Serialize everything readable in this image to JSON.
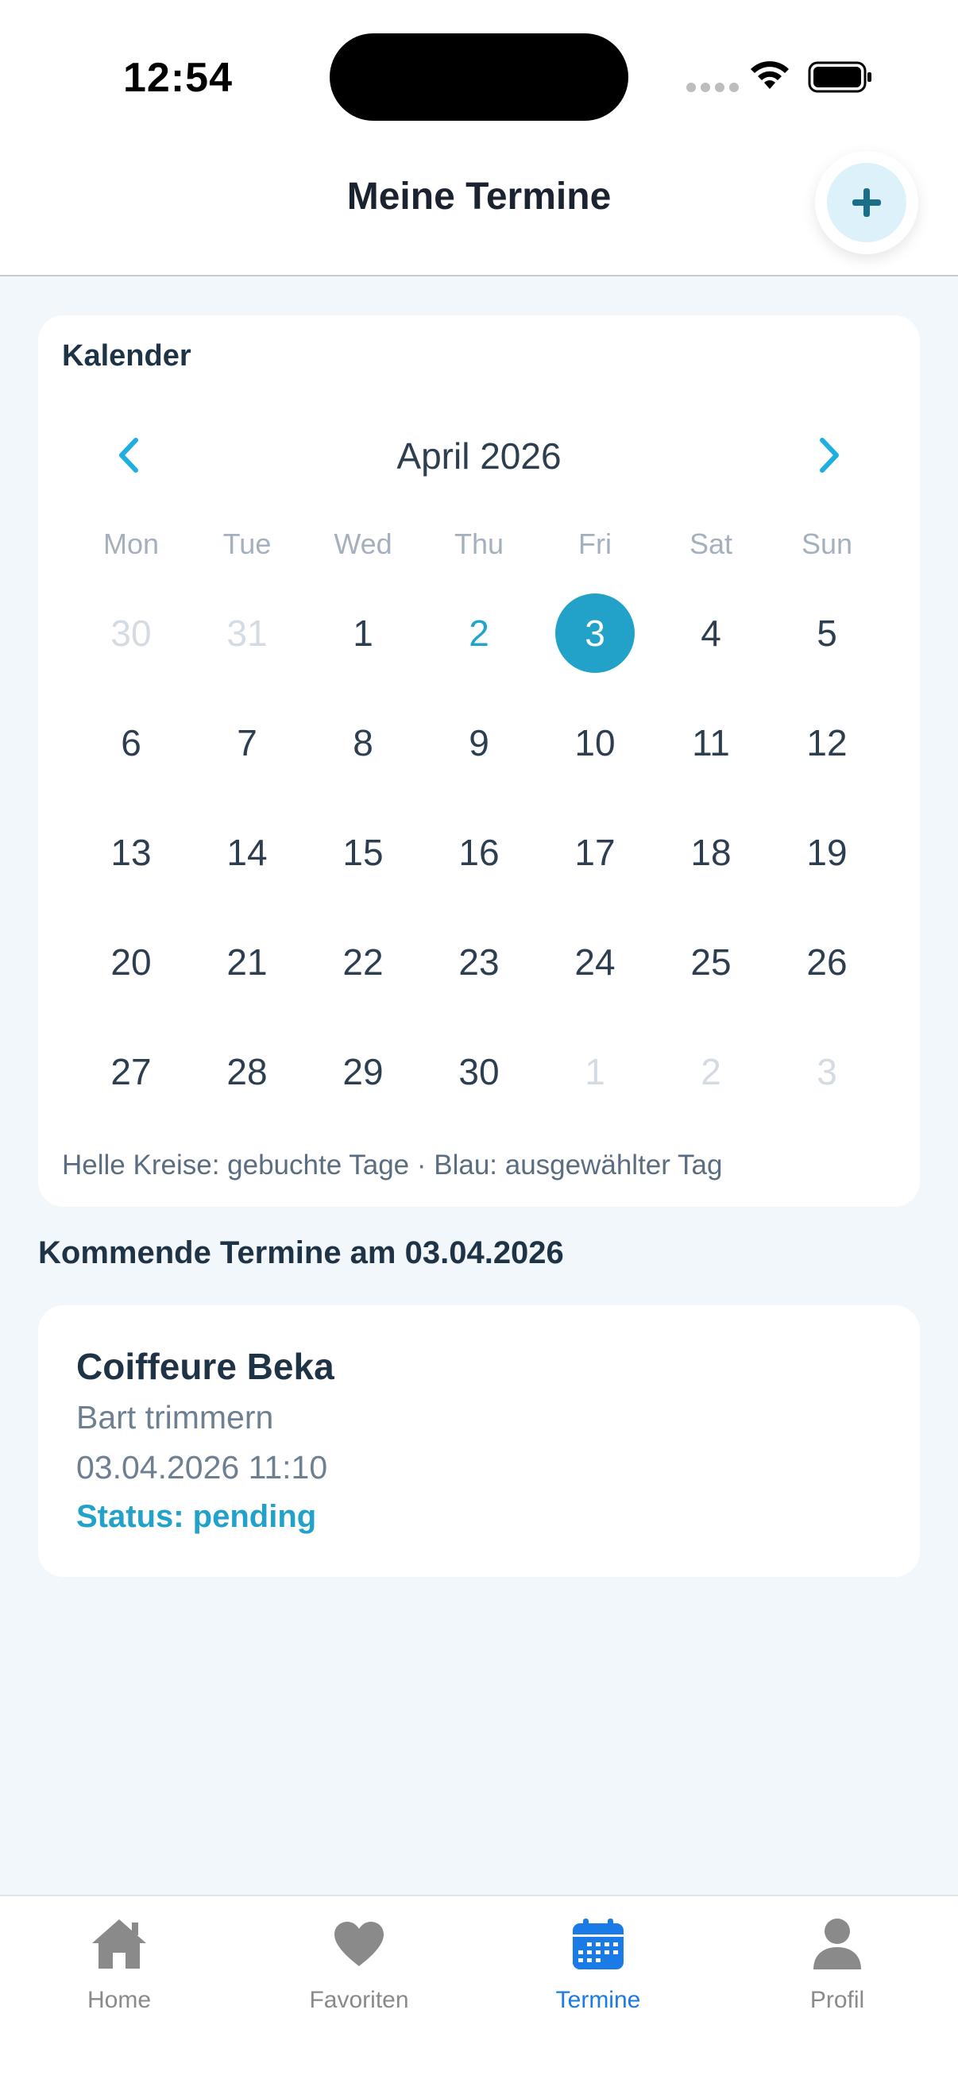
{
  "status_bar": {
    "time": "12:54"
  },
  "header": {
    "title": "Meine Termine",
    "add_label": "+"
  },
  "calendar": {
    "title": "Kalender",
    "month": "April 2026",
    "prev_label": "<",
    "next_label": ">",
    "weekdays": [
      "Mon",
      "Tue",
      "Wed",
      "Thu",
      "Fri",
      "Sat",
      "Sun"
    ],
    "weeks": [
      [
        "30",
        "31",
        "1",
        "2",
        "3",
        "4",
        "5"
      ],
      [
        "6",
        "7",
        "8",
        "9",
        "10",
        "11",
        "12"
      ],
      [
        "13",
        "14",
        "15",
        "16",
        "17",
        "18",
        "19"
      ],
      [
        "20",
        "21",
        "22",
        "23",
        "24",
        "25",
        "26"
      ],
      [
        "27",
        "28",
        "29",
        "30",
        "1",
        "2",
        "3"
      ]
    ],
    "hint": "Helle Kreise: gebuchte Tage · Blau: ausgewählter Tag",
    "selected_day": "3",
    "today_day": "2"
  },
  "upcoming": {
    "title": "Kommende Termine am 03.04.2026",
    "appointments": [
      {
        "salon": "Coiffeure Beka",
        "service": "Bart trimmern",
        "datetime": "03.04.2026 11:10",
        "status": "Status: pending"
      }
    ]
  },
  "tabbar": {
    "items": [
      {
        "label": "Home",
        "icon": "home-icon"
      },
      {
        "label": "Favoriten",
        "icon": "heart-icon"
      },
      {
        "label": "Termine",
        "icon": "calendar-icon"
      },
      {
        "label": "Profil",
        "icon": "person-icon"
      }
    ],
    "active": "Termine"
  },
  "colors": {
    "accent": "#23a2c9",
    "tab_active": "#1a7ae6",
    "background": "#f1f7fa",
    "text_dark": "#1f3347"
  }
}
